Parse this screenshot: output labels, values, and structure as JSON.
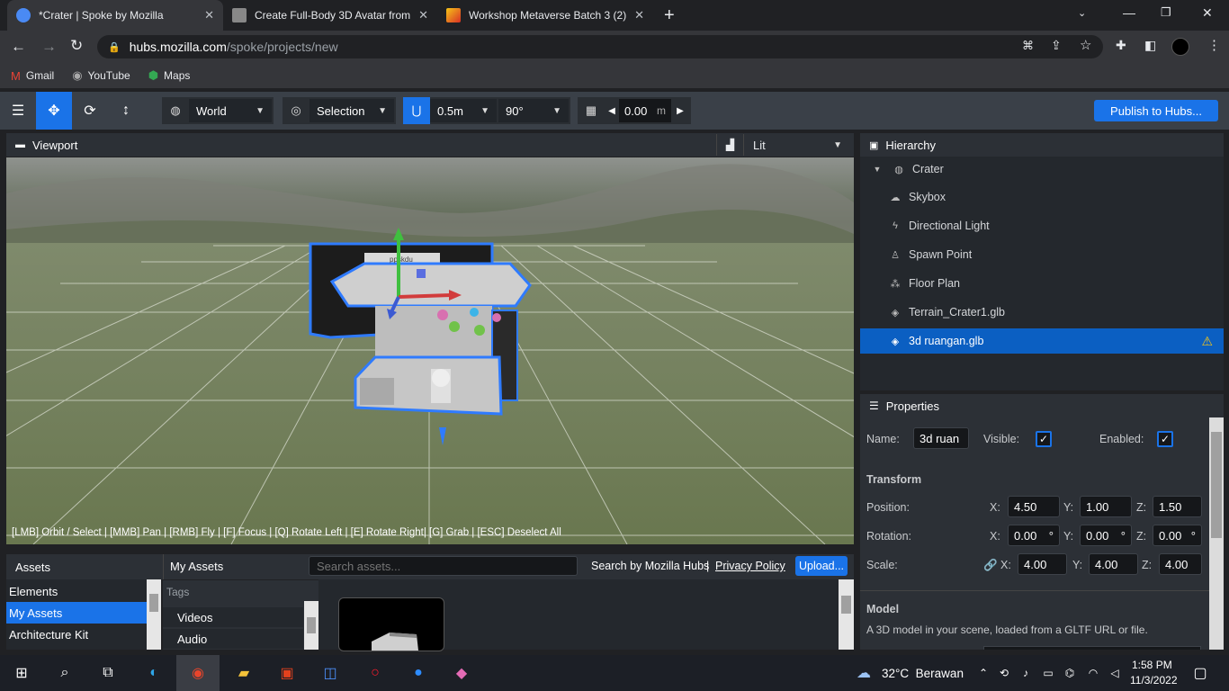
{
  "browser": {
    "tabs": [
      {
        "title": "*Crater | Spoke by Mozilla",
        "active": true
      },
      {
        "title": "Create Full-Body 3D Avatar from",
        "active": false
      },
      {
        "title": "Workshop Metaverse Batch 3 (2)",
        "active": false
      }
    ],
    "url_host": "hubs.mozilla.com",
    "url_path": "/spoke/projects/new",
    "bookmarks": [
      {
        "label": "Gmail",
        "icon": "gmail-icon"
      },
      {
        "label": "YouTube",
        "icon": "youtube-icon"
      },
      {
        "label": "Maps",
        "icon": "maps-icon"
      }
    ]
  },
  "toolbar": {
    "space": "World",
    "pivot": "Selection",
    "snap_translate": "0.5m",
    "snap_rotate": "90°",
    "grid_height": "0.00",
    "grid_unit": "m",
    "publish_label": "Publish to Hubs..."
  },
  "viewport": {
    "title": "Viewport",
    "render_mode": "Lit",
    "hint": "[LMB] Orbit / Select | [MMB] Pan | [RMB] Fly | [F] Focus | [Q] Rotate Left | [E] Rotate Right| [G] Grab | [ESC] Deselect All",
    "model_label": "ppskdu"
  },
  "hierarchy": {
    "title": "Hierarchy",
    "root": "Crater",
    "items": [
      {
        "label": "Skybox",
        "icon": "cloud-icon",
        "selected": false
      },
      {
        "label": "Directional Light",
        "icon": "bolt-icon",
        "selected": false
      },
      {
        "label": "Spawn Point",
        "icon": "person-icon",
        "selected": false
      },
      {
        "label": "Floor Plan",
        "icon": "shoe-prints-icon",
        "selected": false
      },
      {
        "label": "Terrain_Crater1.glb",
        "icon": "cube-icon",
        "selected": false
      },
      {
        "label": "3d ruangan.glb",
        "icon": "cube-icon",
        "selected": true
      }
    ]
  },
  "properties": {
    "title": "Properties",
    "name_label": "Name:",
    "name_value": "3d ruan",
    "visible_label": "Visible:",
    "enabled_label": "Enabled:",
    "transform_title": "Transform",
    "position_label": "Position:",
    "rotation_label": "Rotation:",
    "scale_label": "Scale:",
    "x_label": "X:",
    "y_label": "Y:",
    "z_label": "Z:",
    "position": {
      "x": "4.50",
      "y": "1.00",
      "z": "1.50"
    },
    "rotation": {
      "x": "0.00",
      "y": "0.00",
      "z": "0.00"
    },
    "degree_symbol": "°",
    "scale": {
      "x": "4.00",
      "y": "4.00",
      "z": "4.00"
    },
    "model_title": "Model",
    "model_desc": "A 3D model in your scene, loaded from a GLTF URL or file."
  },
  "assets": {
    "title": "Assets",
    "sources": [
      {
        "label": "Elements",
        "selected": false
      },
      {
        "label": "My Assets",
        "selected": true
      },
      {
        "label": "Architecture Kit",
        "selected": false
      }
    ],
    "panel_title": "My Assets",
    "search_placeholder": "Search assets...",
    "search_by": "Search by Mozilla Hubs",
    "separator": "|",
    "privacy": "Privacy Policy",
    "upload": "Upload...",
    "tags_label": "Tags",
    "tags": [
      "Videos",
      "Audio"
    ]
  },
  "taskbar": {
    "weather": "32°C  Berawan",
    "time": "1:58 PM",
    "date": "11/3/2022"
  },
  "colors": {
    "accent": "#1a73e8",
    "warning": "#f5c518"
  }
}
